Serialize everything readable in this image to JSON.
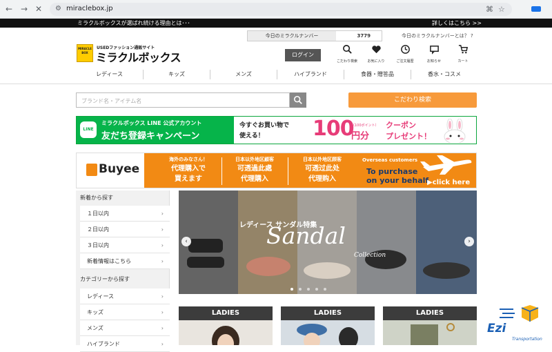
{
  "browser": {
    "url": "miraclebox.jp"
  },
  "announcement": {
    "left": "ミラクルボックスが選ばれ続ける理由とは･･･",
    "right": "詳しくはこちら >>"
  },
  "counter": {
    "label": "今日のミラクルナンバー",
    "value": "3779",
    "help": "今日のミラクルナンバーとは？ ?"
  },
  "logo": {
    "tagline": "USEDファッション通販サイト",
    "name": "ミラクルボックス",
    "badge": "MIRACLE BOX"
  },
  "header": {
    "login": "ログイン",
    "icons": [
      {
        "label": "こだわり検索",
        "icon": "search-icon"
      },
      {
        "label": "お気に入り",
        "icon": "heart-icon"
      },
      {
        "label": "ご注文履歴",
        "icon": "history-icon"
      },
      {
        "label": "お知らせ",
        "icon": "message-icon"
      },
      {
        "label": "カート",
        "icon": "cart-icon"
      }
    ]
  },
  "categories": [
    "レディース",
    "キッズ",
    "メンズ",
    "ハイブランド",
    "食器・贈答品",
    "香水・コスメ"
  ],
  "search": {
    "placeholder": "ブランド名・アイテム名",
    "advanced": "こだわり検索"
  },
  "line_banner": {
    "logo": "LINE",
    "title": "ミラクルボックス LINE 公式アカウント",
    "subtitle": "友だち登録キャンペーン",
    "msg1": "今すぐお買い物で",
    "msg2": "使える！",
    "amount": "100",
    "points_note": "（100ポイント）",
    "unit": "円分",
    "coupon1": "クーポン",
    "coupon2": "プレゼント！"
  },
  "buyee": {
    "name": "Buyee",
    "cols": [
      {
        "small": "海外のみなさん！",
        "big1": "代理購入で",
        "big2": "買えます"
      },
      {
        "small": "日本以外地区顧客",
        "big1": "可透過此處",
        "big2": "代理購入"
      },
      {
        "small": "日本以外地区顾客",
        "big1": "可透过此处",
        "big2": "代理购入"
      }
    ],
    "overseas": "Overseas customers",
    "purchase1": "To purchase",
    "purchase2": "on your behalf,",
    "click": "▶click here"
  },
  "sidebar": {
    "new_header": "新着から探す",
    "new_items": [
      "１日以内",
      "２日以内",
      "３日以内",
      "新着情報はこちら"
    ],
    "cat_header": "カテゴリーから探す",
    "cat_items": [
      "レディース",
      "キッズ",
      "メンズ",
      "ハイブランド"
    ]
  },
  "hero": {
    "title": "レディース サンダル特集",
    "script": "Sandal",
    "sub": "Collection",
    "prev": "‹",
    "next": "›"
  },
  "cards": [
    "LADIES",
    "LADIES",
    "LADIES"
  ],
  "ezi": {
    "name": "Ezi",
    "sub": "Transportation"
  },
  "colors": {
    "accent": "#f79a3b",
    "line_green": "#06b44a",
    "buyee_orange": "#f28a14",
    "coupon_pink": "#e73c78"
  }
}
